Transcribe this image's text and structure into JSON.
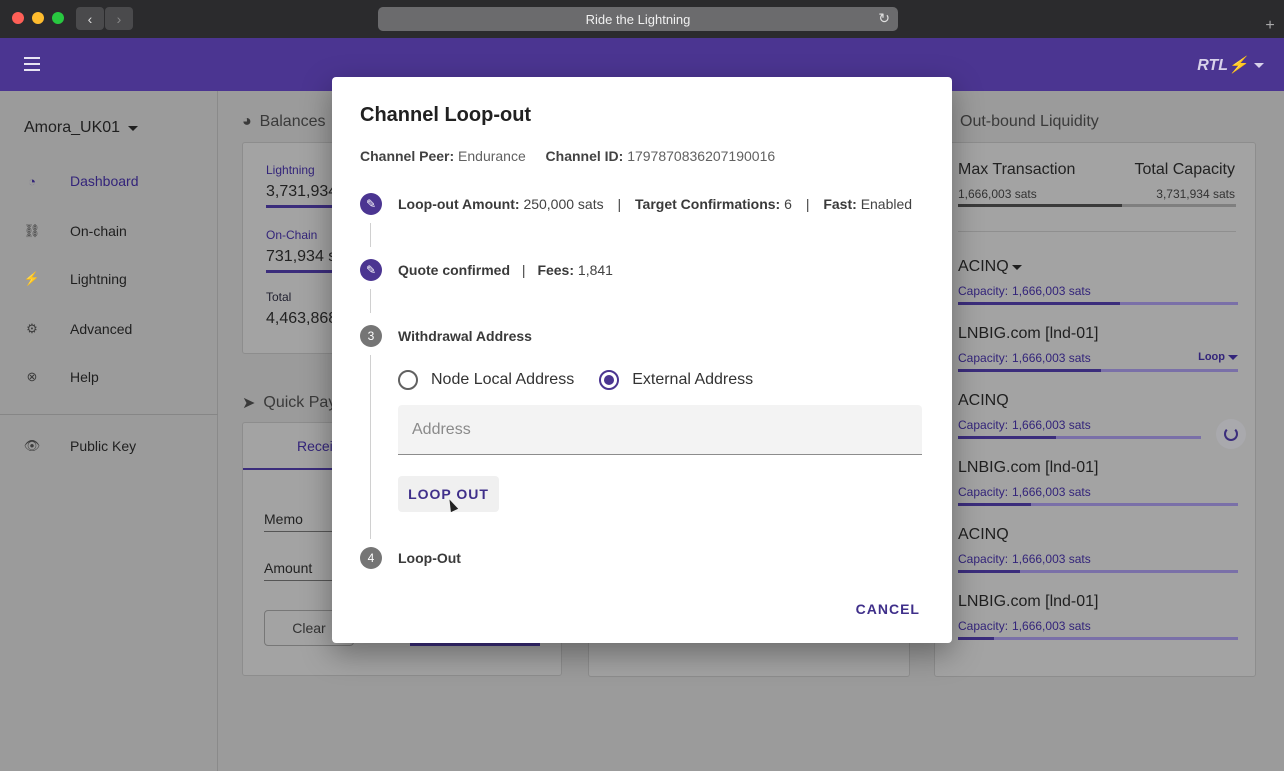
{
  "browser": {
    "url_title": "Ride the Lightning",
    "back_icon": "‹",
    "forward_icon": "›",
    "reload_icon": "↻",
    "new_tab_icon": "+"
  },
  "header": {
    "brand": "RTL⚡"
  },
  "sidebar": {
    "node_name": "Amora_UK01",
    "items": [
      {
        "label": "Dashboard",
        "icon": "gauge-icon",
        "glyph": "◔"
      },
      {
        "label": "On-chain",
        "icon": "link-icon",
        "glyph": "⛓"
      },
      {
        "label": "Lightning",
        "icon": "bolt-icon",
        "glyph": "⚡"
      },
      {
        "label": "Advanced",
        "icon": "gear-icon",
        "glyph": "⚙"
      },
      {
        "label": "Help",
        "icon": "help-icon",
        "glyph": "⊗"
      },
      {
        "label": "Public Key",
        "icon": "eye-icon",
        "glyph": "👁"
      }
    ]
  },
  "balances": {
    "title": "Balances",
    "lightning_label": "Lightning",
    "lightning_value": "3,731,934",
    "onchain_label": "On-Chain",
    "onchain_value": "731,934 s",
    "total_label": "Total",
    "total_value": "4,463,868"
  },
  "quickpay": {
    "title": "Quick Pay",
    "tab_receive": "Recei",
    "memo_label": "Memo",
    "amount_label": "Amount",
    "clear_label": "Clear"
  },
  "liquidity": {
    "title": "Out-bound Liquidity",
    "max_tx_label": "Max Transaction",
    "max_tx_value": "1,666,003 sats",
    "total_cap_label": "Total Capacity",
    "total_cap_value": "3,731,934 sats",
    "channels": [
      {
        "name": "ACINQ",
        "capacity_label": "Capacity:",
        "capacity": "1,666,003 sats",
        "fill": 0.58
      },
      {
        "name": "LNBIG.com [lnd-01]",
        "capacity_label": "Capacity:",
        "capacity": "1,666,003 sats",
        "fill": 0.51,
        "action": "Loop"
      },
      {
        "name": "ACINQ",
        "capacity_label": "Capacity:",
        "capacity": "1,666,003 sats",
        "fill": 0.35
      },
      {
        "name": "LNBIG.com [lnd-01]",
        "capacity_label": "Capacity:",
        "capacity": "1,666,003 sats",
        "fill": 0.26
      },
      {
        "name": "ACINQ",
        "capacity_label": "Capacity:",
        "capacity": "1,666,003 sats",
        "fill": 0.22
      },
      {
        "name": "LNBIG.com [lnd-01]",
        "capacity_label": "Capacity:",
        "capacity": "1,666,003 sats",
        "fill": 0.13
      }
    ]
  },
  "dialog": {
    "title": "Channel Loop-out",
    "peer_label": "Channel Peer:",
    "peer_value": "Endurance",
    "channel_id_label": "Channel ID:",
    "channel_id_value": "1797870836207190016",
    "step1": {
      "amount_label": "Loop-out Amount:",
      "amount_value": "250,000 sats",
      "confirm_label": "Target Confirmations:",
      "confirm_value": "6",
      "fast_label": "Fast:",
      "fast_value": "Enabled",
      "separator": "|"
    },
    "step2": {
      "quote_label": "Quote confirmed",
      "fees_label": "Fees:",
      "fees_value": "1,841",
      "separator": "|"
    },
    "step3": {
      "number": "3",
      "label": "Withdrawal Address",
      "radio_local": "Node Local Address",
      "radio_external": "External Address",
      "selected": "external",
      "address_placeholder": "Address",
      "address_value": "",
      "loop_out_button": "LOOP OUT"
    },
    "step4": {
      "number": "4",
      "label": "Loop-Out"
    },
    "cancel_button": "CANCEL"
  },
  "colors": {
    "primary": "#4b3591",
    "overlay": "#9b9b9b"
  }
}
